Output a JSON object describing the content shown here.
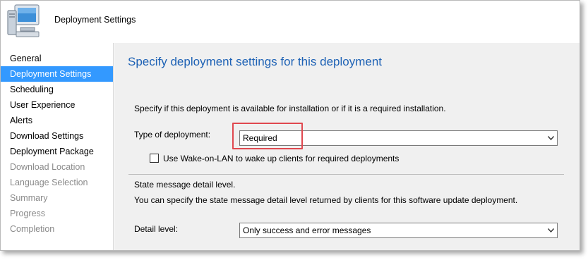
{
  "header": {
    "title": "Deployment Settings",
    "icon": "computer-icon"
  },
  "sidebar": {
    "items": [
      {
        "label": "General",
        "state": "enabled"
      },
      {
        "label": "Deployment Settings",
        "state": "selected"
      },
      {
        "label": "Scheduling",
        "state": "enabled"
      },
      {
        "label": "User Experience",
        "state": "enabled"
      },
      {
        "label": "Alerts",
        "state": "enabled"
      },
      {
        "label": "Download Settings",
        "state": "enabled"
      },
      {
        "label": "Deployment Package",
        "state": "enabled"
      },
      {
        "label": "Download Location",
        "state": "disabled"
      },
      {
        "label": "Language Selection",
        "state": "disabled"
      },
      {
        "label": "Summary",
        "state": "disabled"
      },
      {
        "label": "Progress",
        "state": "disabled"
      },
      {
        "label": "Completion",
        "state": "disabled"
      }
    ]
  },
  "main": {
    "heading": "Specify deployment settings for this deployment",
    "intro": "Specify if this deployment is available for installation or if it is a required installation.",
    "type_label": "Type of deployment:",
    "type_value": "Required",
    "wol_label": "Use Wake-on-LAN to wake up clients for required deployments",
    "wol_checked": false,
    "state_heading": "State message detail level.",
    "state_desc": "You can specify the state message detail level returned by clients for this software update deployment.",
    "detail_label": "Detail level:",
    "detail_value": "Only success and error messages"
  },
  "colors": {
    "selected_bg": "#3399ff",
    "heading": "#1e62b5",
    "highlight_box": "#e0484f"
  }
}
